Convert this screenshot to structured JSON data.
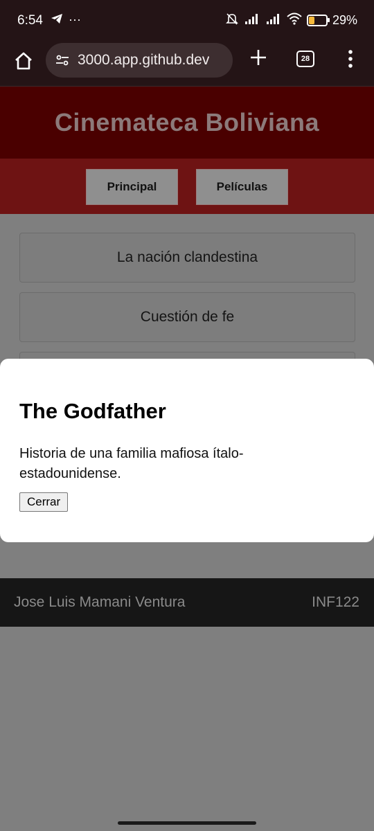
{
  "status_bar": {
    "time": "6:54",
    "battery": "29%",
    "battery_level": 0.29,
    "icons": [
      "telegram-icon",
      "more-notifications-icon",
      "bell-off-icon",
      "signal-icon",
      "signal-icon",
      "wifi-icon",
      "battery-icon"
    ]
  },
  "browser": {
    "url": "3000.app.github.dev",
    "tab_count": "28"
  },
  "page": {
    "title": "Cinemateca Boliviana",
    "nav": [
      "Principal",
      "Películas"
    ],
    "movies": [
      "La nación clandestina",
      "Cuestión de fe"
    ],
    "footer": {
      "author": "Jose Luis Mamani Ventura",
      "course": "INF122"
    }
  },
  "modal": {
    "title": "The Godfather",
    "description": "Historia de una familia mafiosa ítalo-estadounidense.",
    "close_label": "Cerrar"
  },
  "colors": {
    "header": "#4a0000",
    "nav": "#6e1313",
    "overlay": "#7f7f7f",
    "footer": "#161616"
  }
}
